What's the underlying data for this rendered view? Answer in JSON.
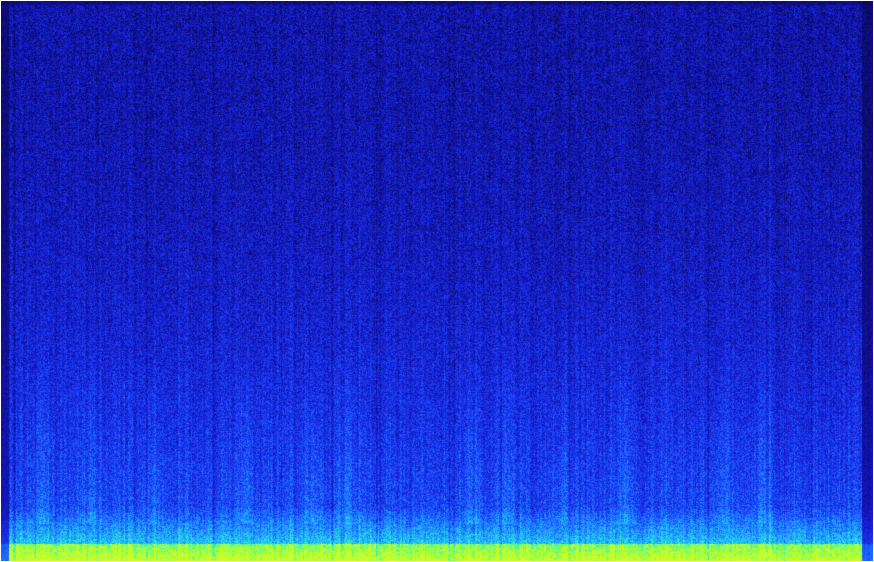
{
  "image": {
    "kind": "spectrogram",
    "colormap": [
      "#0a0a55",
      "#1414c8",
      "#1e5aff",
      "#28c8ff",
      "#50ff78",
      "#c8ff28"
    ],
    "background_color": "#1f23d6",
    "border_color": "#ffffff"
  }
}
